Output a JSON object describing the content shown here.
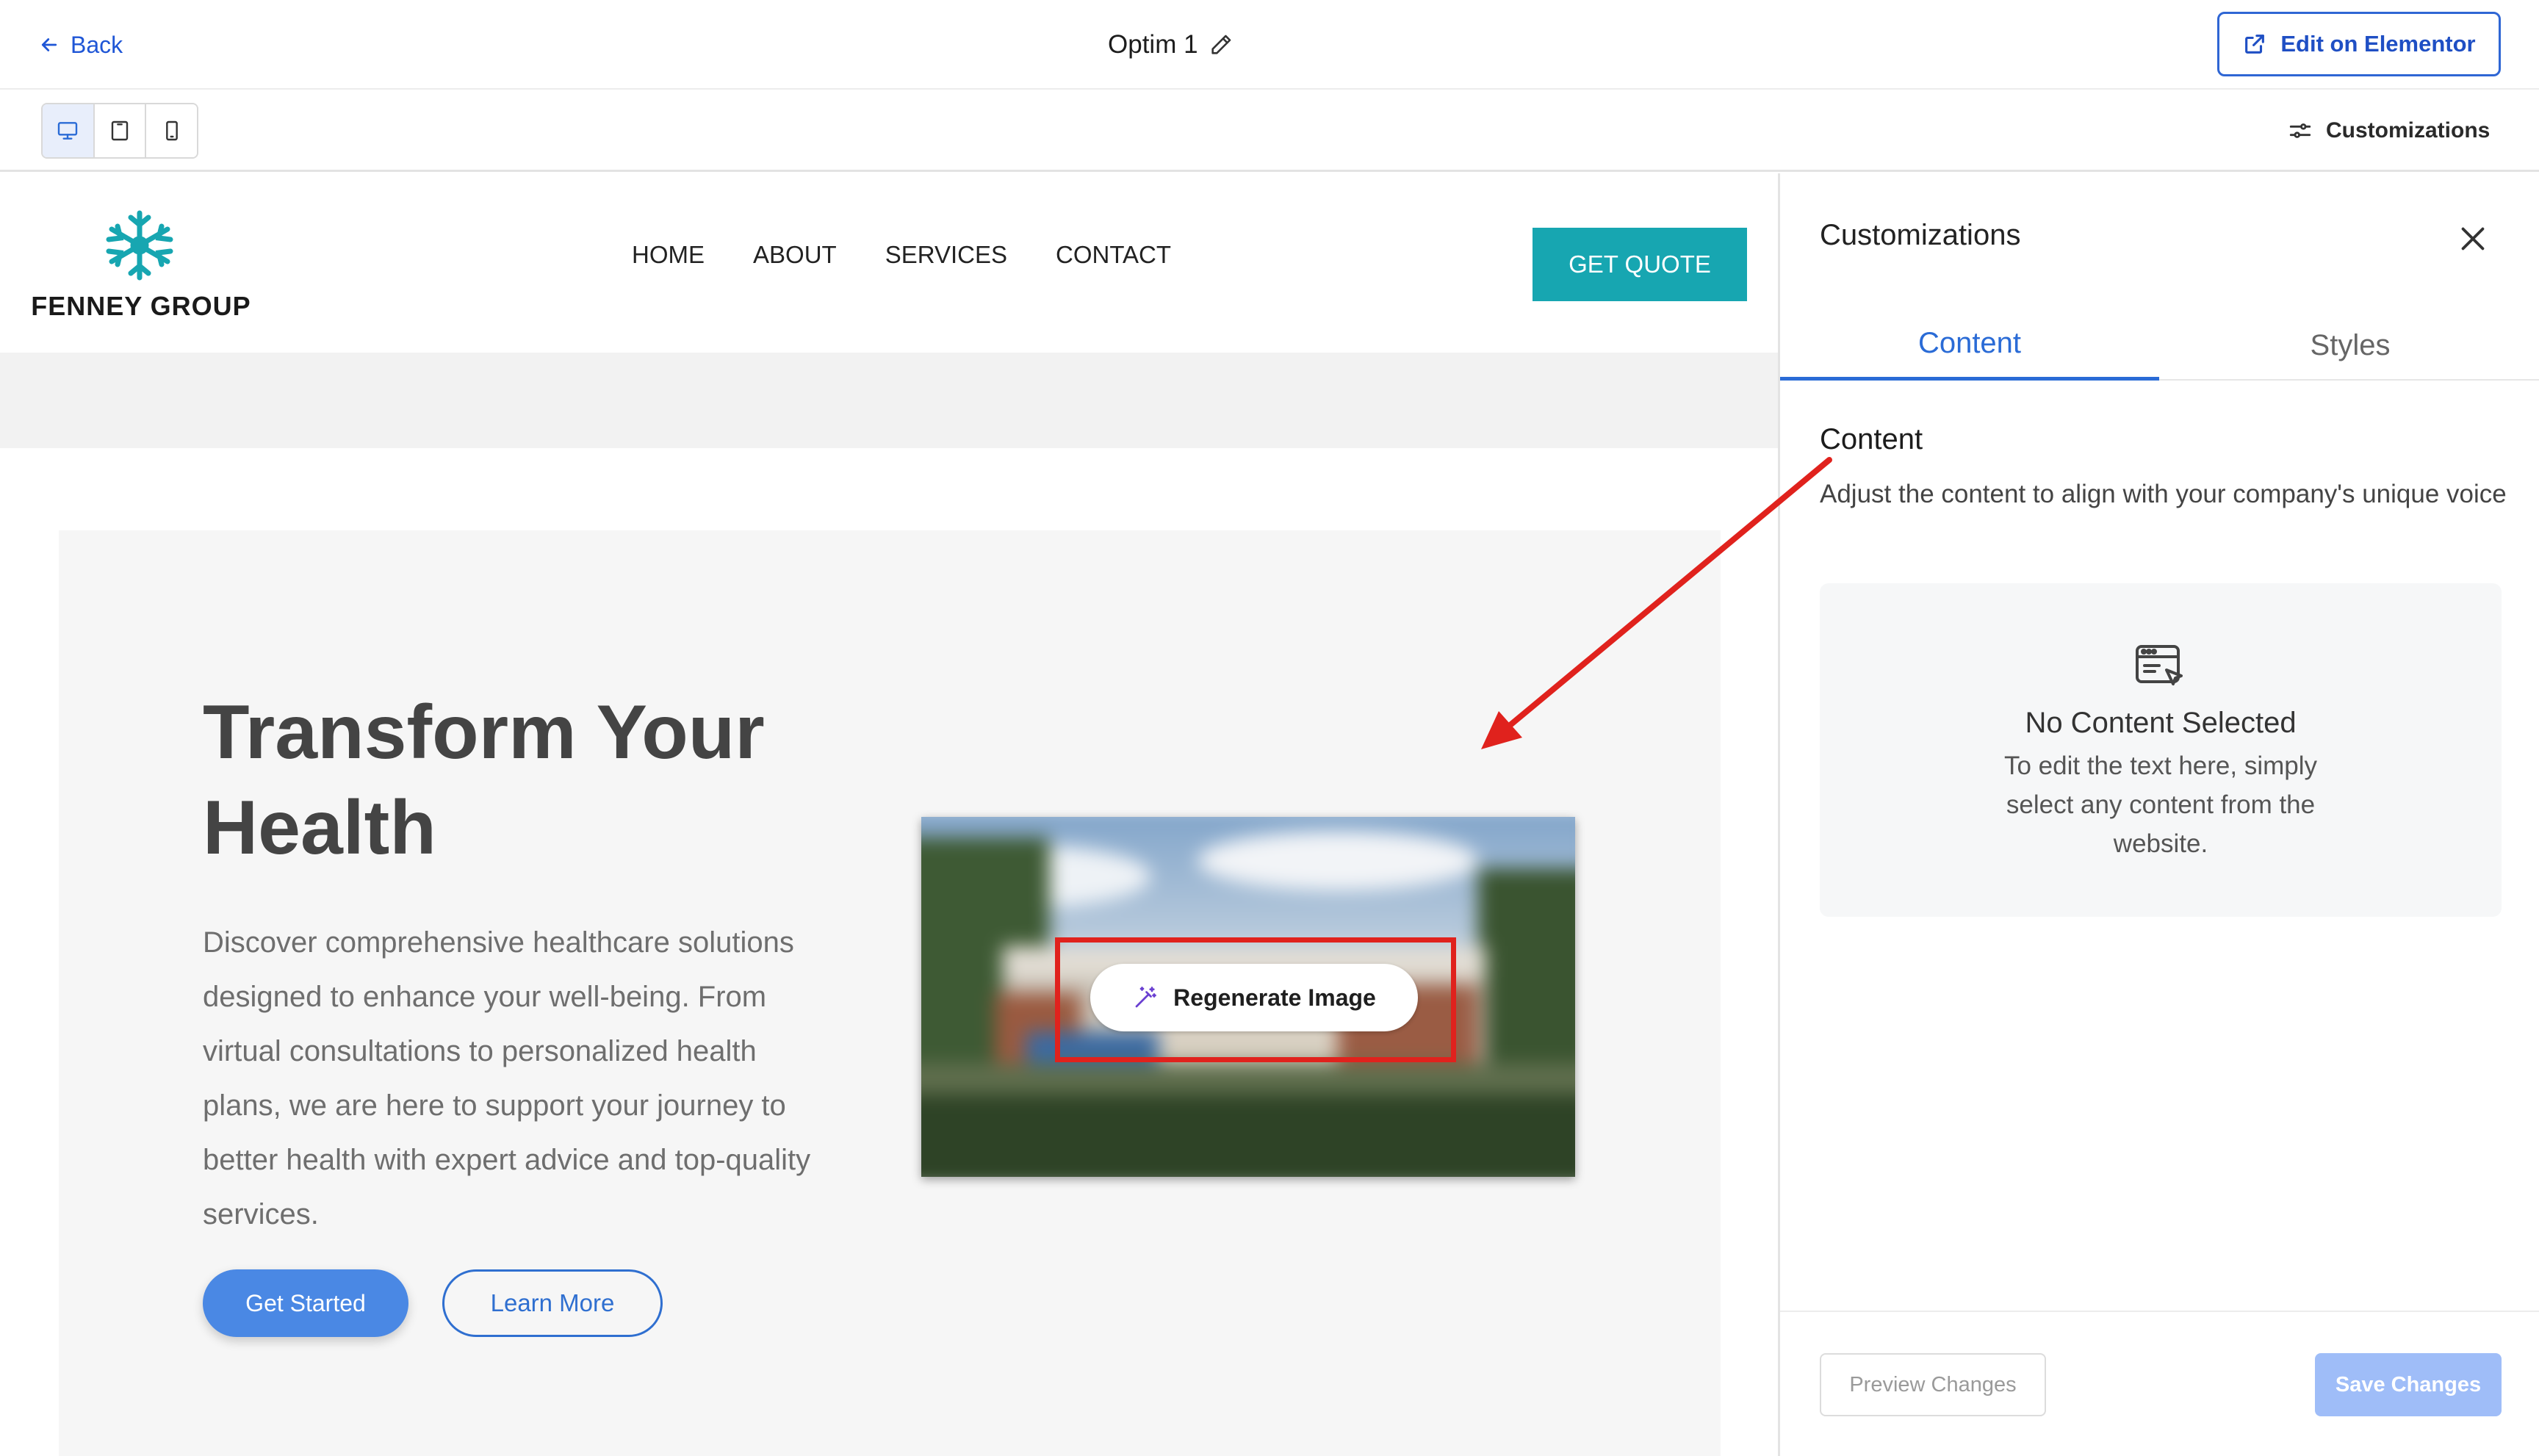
{
  "topbar": {
    "back_label": "Back",
    "doc_title": "Optim 1",
    "edit_button_label": "Edit on Elementor"
  },
  "subbar": {
    "devices": [
      "desktop-icon",
      "tablet-icon",
      "mobile-icon"
    ],
    "active_device": "desktop",
    "customizations_label": "Customizations"
  },
  "site": {
    "logo_text": "FENNEY GROUP",
    "nav": [
      "HOME",
      "ABOUT",
      "SERVICES",
      "CONTACT"
    ],
    "cta_label": "GET QUOTE",
    "hero": {
      "title": "Transform Your Health",
      "description": "Discover comprehensive healthcare solutions designed to enhance your well-being. From virtual consultations to personalized health plans, we are here to support your journey to better health with expert advice and top-quality services.",
      "primary_button": "Get Started",
      "secondary_button": "Learn More",
      "regenerate_label": "Regenerate Image"
    }
  },
  "panel": {
    "title": "Customizations",
    "tabs": [
      {
        "label": "Content",
        "active": true
      },
      {
        "label": "Styles",
        "active": false
      }
    ],
    "section_heading": "Content",
    "section_desc": "Adjust the content to align with your company's unique voice",
    "empty_title": "No Content Selected",
    "empty_desc": "To edit the text here, simply select any content from the website.",
    "preview_button": "Preview Changes",
    "save_button": "Save Changes"
  },
  "colors": {
    "accent_blue": "#2a6bd6",
    "brand_teal": "#17a6b1",
    "annotation_red": "#e0221d",
    "save_disabled": "#9fbdf8"
  }
}
